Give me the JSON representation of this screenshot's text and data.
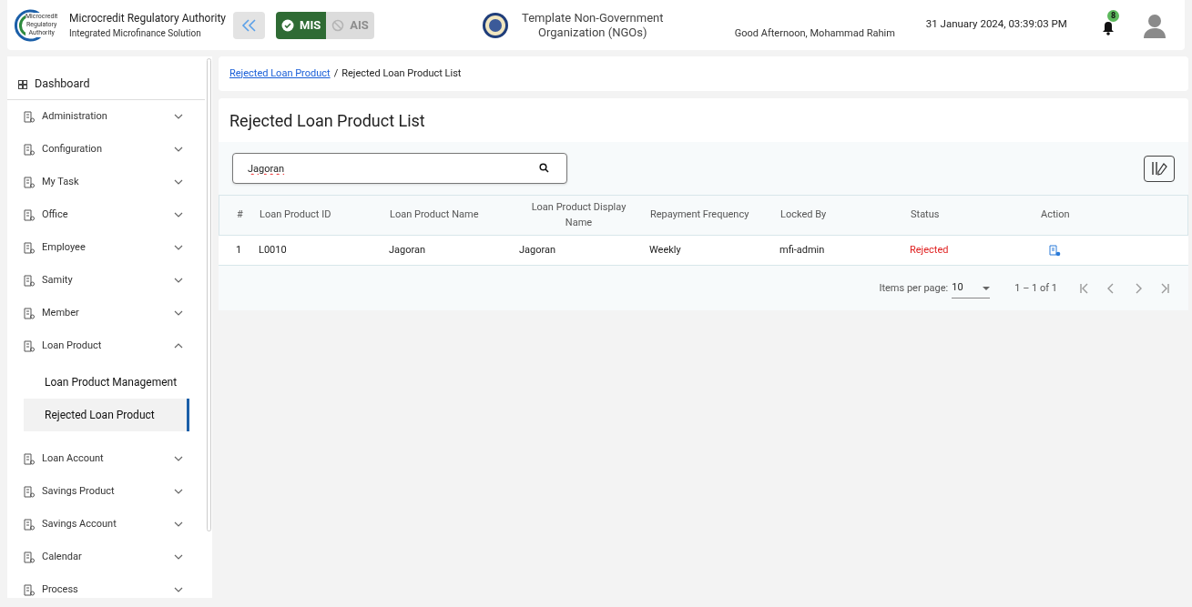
{
  "header": {
    "org_name": "Microcredit Regulatory Authority",
    "org_subtitle": "Integrated Microfinance Solution",
    "logo_text": [
      "Microcredit",
      "Regulatory",
      "Authority"
    ],
    "modes": [
      {
        "label": "MIS",
        "selected": true
      },
      {
        "label": "AIS",
        "selected": false
      }
    ],
    "ngo_name": "Template Non-Government Organization (NGOs)",
    "greeting": "Good Afternoon, Mohammad Rahim",
    "datetime": "31 January 2024, 03:39:03 PM",
    "notification_count": "8"
  },
  "sidebar": {
    "dashboard": "Dashboard",
    "items": [
      {
        "label": "Administration",
        "expanded": false
      },
      {
        "label": "Configuration",
        "expanded": false
      },
      {
        "label": "My Task",
        "expanded": false
      },
      {
        "label": "Office",
        "expanded": false
      },
      {
        "label": "Employee",
        "expanded": false
      },
      {
        "label": "Samity",
        "expanded": false
      },
      {
        "label": "Member",
        "expanded": false
      },
      {
        "label": "Loan Product",
        "expanded": true,
        "children": [
          {
            "label": "Loan Product Management",
            "selected": false
          },
          {
            "label": "Rejected Loan Product",
            "selected": true
          }
        ]
      },
      {
        "label": "Loan Account",
        "expanded": false
      },
      {
        "label": "Savings Product",
        "expanded": false
      },
      {
        "label": "Savings Account",
        "expanded": false
      },
      {
        "label": "Calendar",
        "expanded": false
      },
      {
        "label": "Process",
        "expanded": false
      }
    ]
  },
  "breadcrumb": {
    "link": "Rejected Loan Product",
    "separator": "/",
    "current": "Rejected Loan Product List"
  },
  "page_title": "Rejected Loan Product List",
  "search": {
    "value": "Jagoran"
  },
  "table": {
    "columns": [
      "#",
      "Loan Product ID",
      "Loan Product Name",
      "Loan Product Display Name",
      "Repayment Frequency",
      "Locked By",
      "Status",
      "Action"
    ],
    "rows": [
      {
        "index": "1",
        "id": "L0010",
        "name": "Jagoran",
        "display_name": "Jagoran",
        "frequency": "Weekly",
        "locked_by": "mfi-admin",
        "status": "Rejected"
      }
    ]
  },
  "paginator": {
    "label": "Items per page:",
    "page_size": "10",
    "range": "1 – 1 of 1"
  }
}
